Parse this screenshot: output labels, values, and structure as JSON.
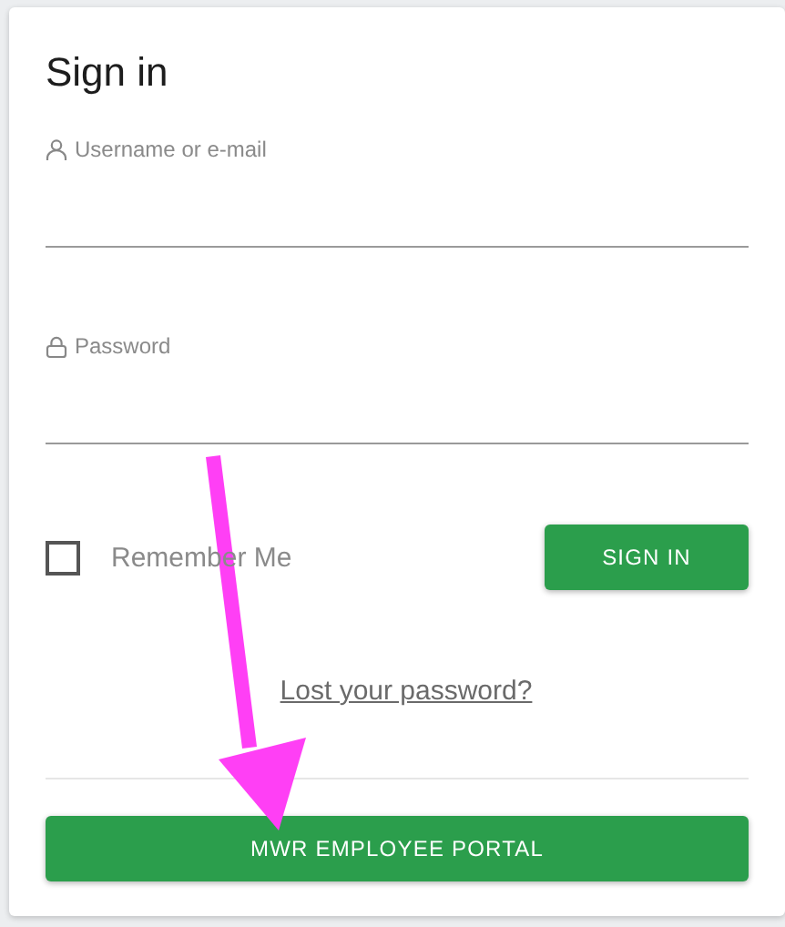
{
  "title": "Sign in",
  "fields": [
    {
      "kind": "user",
      "label": "Username or e-mail"
    },
    {
      "kind": "lock",
      "label": "Password"
    }
  ],
  "remember": {
    "label": "Remember Me",
    "checked": false
  },
  "sign_in_button": "SIGN IN",
  "lost_password_link": "Lost your password?",
  "portal_button": "MWR EMPLOYEE PORTAL",
  "annotation": {
    "kind": "arrow"
  }
}
